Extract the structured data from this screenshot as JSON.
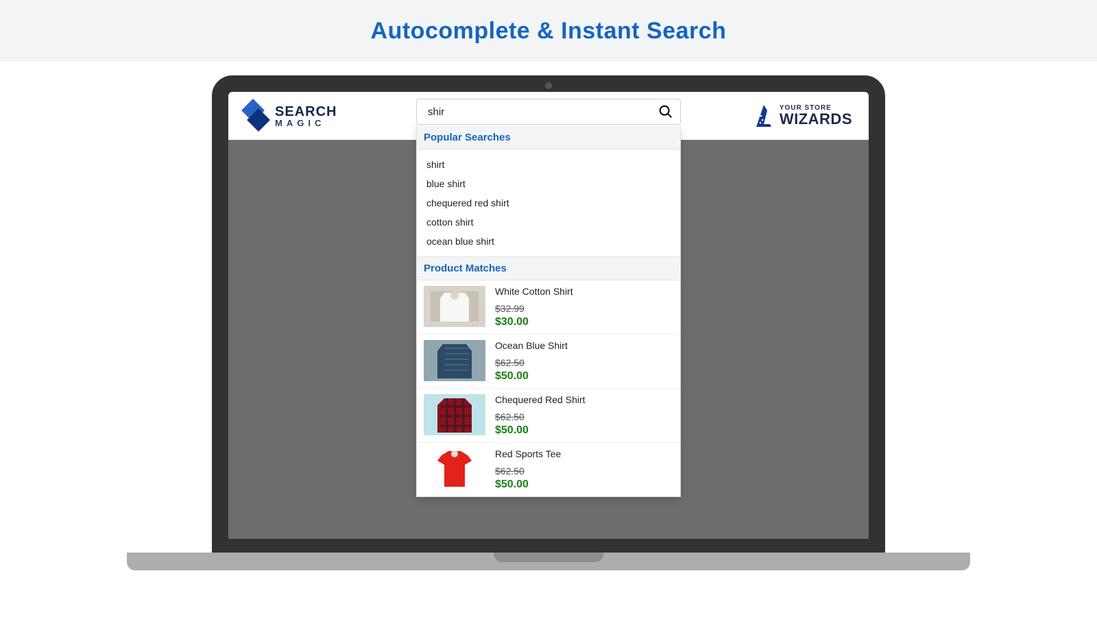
{
  "banner": {
    "title": "Autocomplete & Instant Search"
  },
  "logos": {
    "left": {
      "line1": "SEARCH",
      "line2": "MAGIC"
    },
    "right": {
      "small": "YOUR STORE",
      "big": "WIZARDS"
    }
  },
  "search": {
    "value": "shir"
  },
  "dropdown": {
    "popular": {
      "header": "Popular Searches",
      "items": [
        "shirt",
        "blue shirt",
        "chequered red shirt",
        "cotton shirt",
        "ocean blue shirt"
      ]
    },
    "products": {
      "header": "Product Matches",
      "items": [
        {
          "name": "White Cotton Shirt",
          "old_price": "$32.99",
          "new_price": "$30.00",
          "swatch": "white"
        },
        {
          "name": "Ocean Blue Shirt",
          "old_price": "$62.50",
          "new_price": "$50.00",
          "swatch": "ocean"
        },
        {
          "name": "Chequered Red Shirt",
          "old_price": "$62.50",
          "new_price": "$50.00",
          "swatch": "plaid"
        },
        {
          "name": "Red Sports Tee",
          "old_price": "$62.50",
          "new_price": "$50.00",
          "swatch": "redtee"
        }
      ]
    }
  }
}
